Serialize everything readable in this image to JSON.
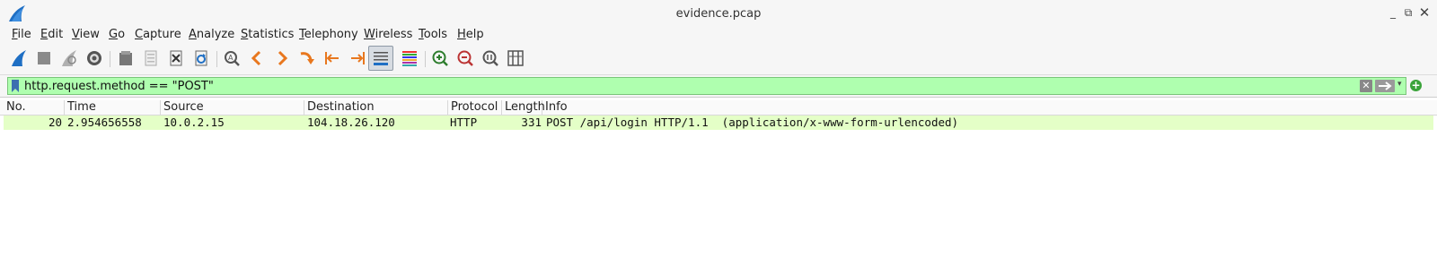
{
  "window": {
    "title": "evidence.pcap",
    "controls": {
      "minimize": "_",
      "maximize": "⧉",
      "close": "✕"
    }
  },
  "menu": [
    "File",
    "Edit",
    "View",
    "Go",
    "Capture",
    "Analyze",
    "Statistics",
    "Telephony",
    "Wireless",
    "Tools",
    "Help"
  ],
  "toolbar": {
    "icons": [
      "start-capture-icon",
      "stop-capture-icon",
      "restart-capture-icon",
      "capture-options-icon",
      "open-file-icon",
      "save-file-icon",
      "close-file-icon",
      "reload-file-icon",
      "find-packet-icon",
      "go-back-icon",
      "go-forward-icon",
      "go-to-packet-icon",
      "go-first-icon",
      "go-last-icon",
      "autoscroll-icon",
      "colorize-icon",
      "zoom-in-icon",
      "zoom-out-icon",
      "normal-size-icon",
      "resize-columns-icon"
    ]
  },
  "filter": {
    "value": "http.request.method == \"POST\"",
    "clear": "✕",
    "dropdown": "▾",
    "add": "+"
  },
  "packet_list": {
    "columns": [
      "No.",
      "Time",
      "Source",
      "Destination",
      "Protocol",
      "Length",
      "Info"
    ],
    "rows": [
      {
        "no": "20",
        "time": "2.954656558",
        "source": "10.0.2.15",
        "destination": "104.18.26.120",
        "protocol": "HTTP",
        "length": "331",
        "info": "POST /api/login HTTP/1.1  (application/x-www-form-urlencoded)"
      }
    ]
  },
  "colors": {
    "filter_valid_bg": "#afffaf",
    "http_row_bg": "#e4ffc7",
    "accent": "#e8771e"
  }
}
